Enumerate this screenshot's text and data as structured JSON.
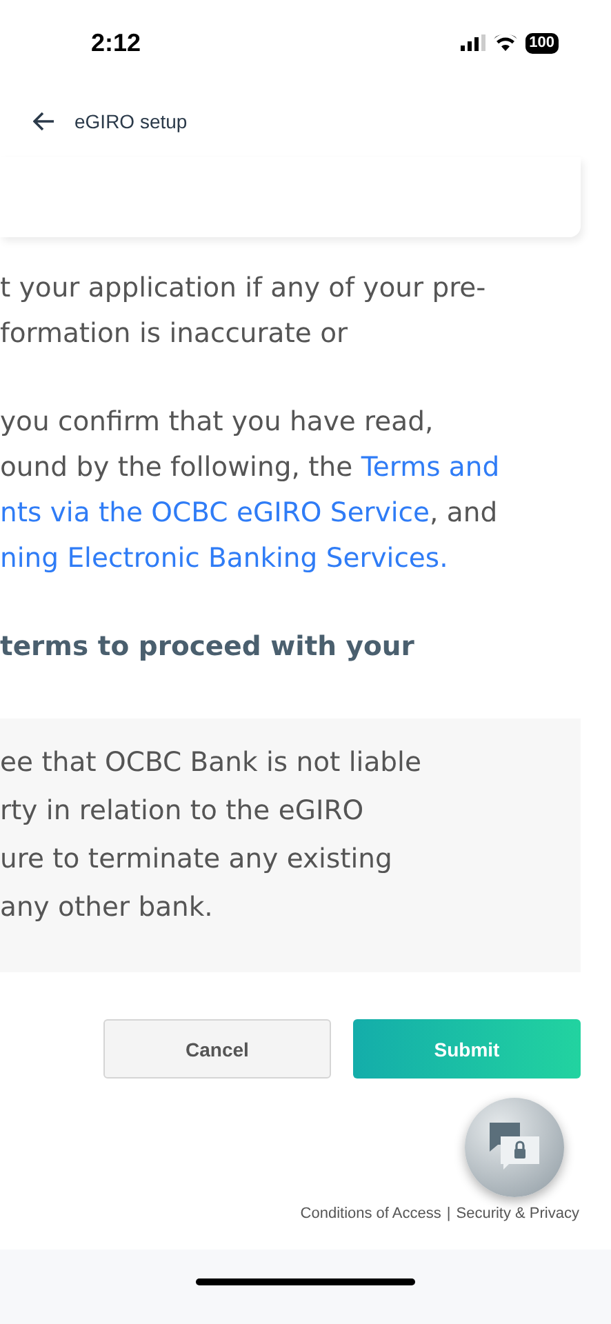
{
  "status_bar": {
    "time": "2:12",
    "battery": "100"
  },
  "header": {
    "title": "eGIRO setup"
  },
  "paragraphs": [
    [
      [
        {
          "kind": "text",
          "text": "t your application if any of your pre-"
        }
      ],
      [
        {
          "kind": "text",
          "text": "formation is inaccurate or"
        }
      ]
    ],
    [
      [
        {
          "kind": "text",
          "text": "you confirm that you have read,"
        }
      ],
      [
        {
          "kind": "text",
          "text": "ound by the following, the "
        },
        {
          "kind": "link",
          "text": "Terms and"
        }
      ],
      [
        {
          "kind": "link",
          "text": "nts via the OCBC eGIRO Service"
        },
        {
          "kind": "text",
          "text": ", and"
        }
      ],
      [
        {
          "kind": "link",
          "text": "ning Electronic Banking Services."
        }
      ]
    ],
    [
      [
        {
          "kind": "heading",
          "text": "terms to proceed with your"
        }
      ]
    ]
  ],
  "terms_box": {
    "lines": [
      "ee that OCBC Bank is not liable",
      "rty in relation to the eGIRO",
      "ure to terminate any existing",
      "any other bank."
    ]
  },
  "buttons": [
    {
      "kind": "secondary",
      "label": "Cancel"
    },
    {
      "kind": "primary",
      "label": "Submit"
    }
  ],
  "footer": {
    "links": [
      "Conditions of Access",
      "Security & Privacy"
    ],
    "separator": "|"
  }
}
